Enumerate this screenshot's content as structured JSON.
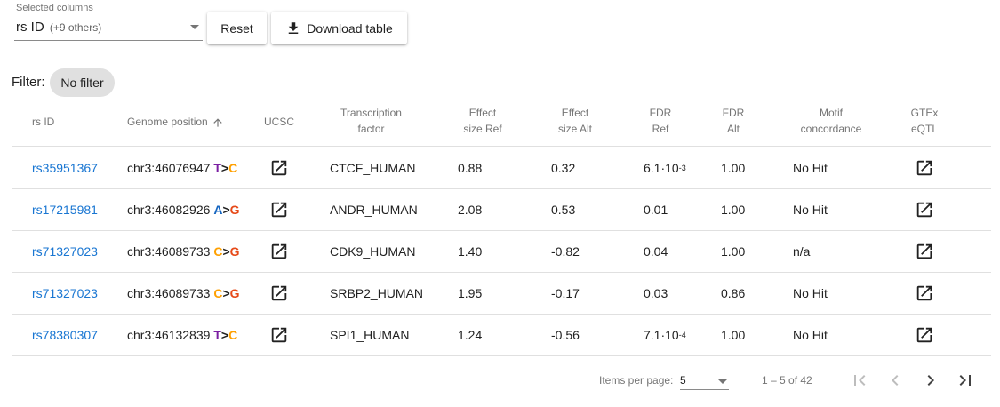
{
  "controls": {
    "selected_columns_label": "Selected columns",
    "selected_columns_value": "rs ID",
    "selected_columns_others": "(+9 others)",
    "reset_label": "Reset",
    "download_label": "Download table"
  },
  "filter": {
    "label": "Filter:",
    "chip": "No filter"
  },
  "colors": {
    "link": "#1976d2",
    "T": "#7b1fa2",
    "C": "#ffa000",
    "A": "#1565c0",
    "G": "#e64a19"
  },
  "icons": {
    "download": "download-icon",
    "external": "open-in-new-icon",
    "sort": "arrow-upward-icon"
  },
  "table": {
    "columns": [
      {
        "key": "rsid",
        "lines": [
          "rs ID"
        ]
      },
      {
        "key": "genome",
        "lines": [
          "Genome position"
        ],
        "sorted": "ascending"
      },
      {
        "key": "ucsc",
        "lines": [
          "UCSC"
        ]
      },
      {
        "key": "tf",
        "lines": [
          "Transcription",
          "factor"
        ]
      },
      {
        "key": "esr",
        "lines": [
          "Effect",
          "size Ref"
        ]
      },
      {
        "key": "esa",
        "lines": [
          "Effect",
          "size Alt"
        ]
      },
      {
        "key": "fdrr",
        "lines": [
          "FDR",
          "Ref"
        ]
      },
      {
        "key": "fdra",
        "lines": [
          "FDR",
          "Alt"
        ]
      },
      {
        "key": "motif",
        "lines": [
          "Motif",
          "concordance"
        ]
      },
      {
        "key": "gtex",
        "lines": [
          "GTEx",
          "eQTL"
        ]
      }
    ],
    "rows": [
      {
        "rsid": "rs35951367",
        "position": "chr3:46076947",
        "ref": "T",
        "alt": "C",
        "tf": "CTCF_HUMAN",
        "es_ref": "0.88",
        "es_alt": "0.32",
        "fdr_ref": {
          "mantissa": "6.1·10",
          "exp": "-3"
        },
        "fdr_alt": "1.00",
        "motif": "No Hit"
      },
      {
        "rsid": "rs17215981",
        "position": "chr3:46082926",
        "ref": "A",
        "alt": "G",
        "tf": "ANDR_HUMAN",
        "es_ref": "2.08",
        "es_alt": "0.53",
        "fdr_ref": {
          "mantissa": "0.01",
          "exp": ""
        },
        "fdr_alt": "1.00",
        "motif": "No Hit"
      },
      {
        "rsid": "rs71327023",
        "position": "chr3:46089733",
        "ref": "C",
        "alt": "G",
        "tf": "CDK9_HUMAN",
        "es_ref": "1.40",
        "es_alt": "-0.82",
        "fdr_ref": {
          "mantissa": "0.04",
          "exp": ""
        },
        "fdr_alt": "1.00",
        "motif": "n/a"
      },
      {
        "rsid": "rs71327023",
        "position": "chr3:46089733",
        "ref": "C",
        "alt": "G",
        "tf": "SRBP2_HUMAN",
        "es_ref": "1.95",
        "es_alt": "-0.17",
        "fdr_ref": {
          "mantissa": "0.03",
          "exp": ""
        },
        "fdr_alt": "0.86",
        "motif": "No Hit"
      },
      {
        "rsid": "rs78380307",
        "position": "chr3:46132839",
        "ref": "T",
        "alt": "C",
        "tf": "SPI1_HUMAN",
        "es_ref": "1.24",
        "es_alt": "-0.56",
        "fdr_ref": {
          "mantissa": "7.1·10",
          "exp": "-4"
        },
        "fdr_alt": "1.00",
        "motif": "No Hit"
      }
    ]
  },
  "paginator": {
    "items_per_page_label": "Items per page:",
    "items_per_page_value": "5",
    "range_label": "1 – 5 of 42"
  }
}
